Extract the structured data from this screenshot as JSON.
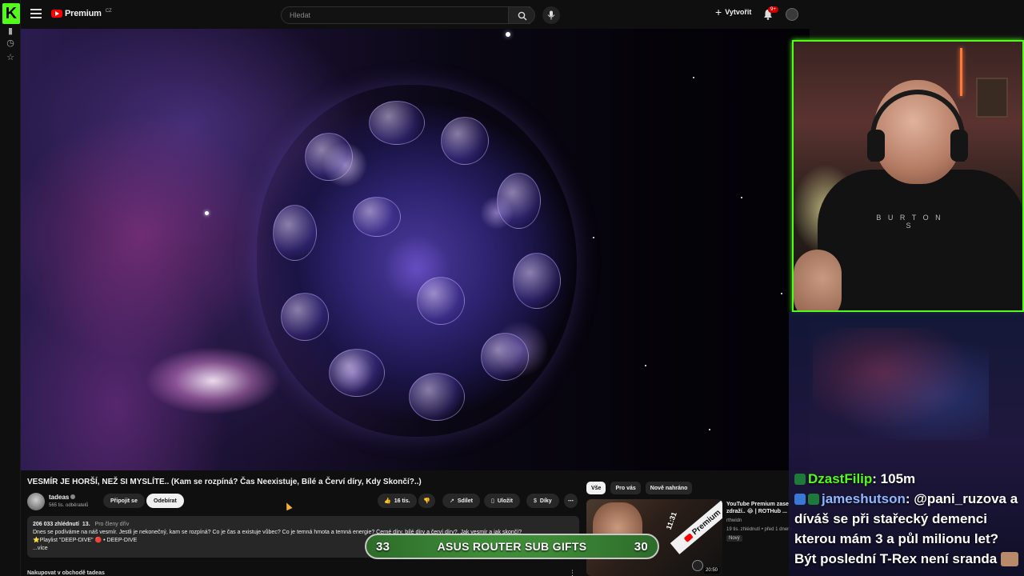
{
  "kick": {
    "logo": "K"
  },
  "header": {
    "brand": "Premium",
    "brand_suffix": "CZ",
    "search_placeholder": "Hledat",
    "create_label": "Vytvořit",
    "notifications_badge": "9+"
  },
  "video": {
    "title": "VESMÍR JE HORŠÍ, NEŽ SI MYSLÍTE.. (Kam se rozpíná? Čas Neexistuje, Bílé a Červí díry, Kdy Skončí?..)",
    "channel_name": "tadeas",
    "subscribers": "565 tis. odběratelů",
    "join_label": "Připojit se",
    "subscribe_label": "Odebírat",
    "likes": "16 tis.",
    "share_label": "Sdílet",
    "save_label": "Uložit",
    "thanks_label": "Díky",
    "views": "206 033 zhlédnutí",
    "date": "13.",
    "members_label": "Pro členy dřív",
    "description_line1": "Dnes se podíváme na náš vesmír. Jestli je nekonečný, kam se rozpíná? Co je čas a existuje vůbec? Co je temná hmota a temná energie? Černé díry, bílé díry a červí díry?. Jak vesmír a jak skončí?",
    "description_line2": "⭐Playlist \"DEEP-DIVE\" 🔴 • DEEP-DIVE",
    "more_label": "...více",
    "shop_label": "Nakupovat v obchodě tadeas"
  },
  "recommendations": {
    "chips": [
      "Vše",
      "Pro vás",
      "Nově nahráno"
    ],
    "item": {
      "title": "YouTube Premium zase zdraží.. 😂 | ROTHub ...",
      "channel": "rthwidn",
      "views": "19 tis. zhlédnutí • před 1 dnem",
      "badge": "Nový",
      "duration": "20:50",
      "thumb_tag": "11:31",
      "thumb_banner": "Premium"
    }
  },
  "chat": {
    "messages": [
      {
        "user": "DzastFilip",
        "user_color": "#53fc18",
        "text": ": 105m"
      },
      {
        "user": "jameshutson",
        "user_color": "#8fb8ff",
        "text": ": @pani_ruzova a díváš se při stařecký demenci kterou mám 3 a půl milionu let? Být poslední T-Rex není sranda"
      }
    ]
  },
  "sub_goal": {
    "left_count": "33",
    "label": "ASUS ROUTER SUB GIFTS",
    "right_count": "30"
  },
  "colors": {
    "kick_green": "#53fc18",
    "yt_red": "#ff0000",
    "sub_bar_green": "#3f8c38"
  }
}
